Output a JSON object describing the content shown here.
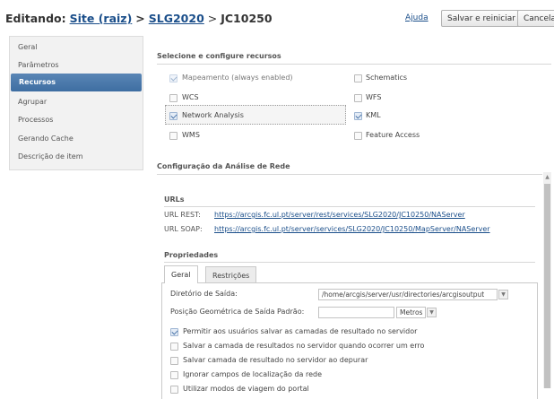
{
  "header": {
    "editing_label": "Editando:",
    "crumb_root": "Site (raiz)",
    "sep1": ">",
    "crumb_folder": "SLG2020",
    "sep2": ">",
    "service": "JC10250",
    "help_link": "Ajuda",
    "save_restart_button": "Salvar e reiniciar",
    "cancel_button": "Cancelar"
  },
  "sidebar": {
    "items": [
      {
        "label": "Geral",
        "active": false
      },
      {
        "label": "Parâmetros",
        "active": false
      },
      {
        "label": "Recursos",
        "active": true
      },
      {
        "label": "Agrupar",
        "active": false
      },
      {
        "label": "Processos",
        "active": false
      },
      {
        "label": "Gerando Cache",
        "active": false
      },
      {
        "label": "Descrição de item",
        "active": false
      }
    ]
  },
  "capabilities": {
    "title": "Selecione e configure recursos",
    "items": [
      {
        "label": "Mapeamento (always enabled)",
        "checked": true,
        "disabled": true
      },
      {
        "label": "Schematics",
        "checked": false
      },
      {
        "label": "WCS",
        "checked": false
      },
      {
        "label": "WFS",
        "checked": false
      },
      {
        "label": "Network Analysis",
        "checked": true,
        "selected": true
      },
      {
        "label": "KML",
        "checked": true
      },
      {
        "label": "WMS",
        "checked": false
      },
      {
        "label": "Feature Access",
        "checked": false
      }
    ]
  },
  "network_config": {
    "title": "Configuração da Análise de Rede",
    "urls_title": "URLs",
    "rest_label": "URL REST:",
    "rest_url": "https://arcgis.fc.ul.pt/server/rest/services/SLG2020/JC10250/NAServer",
    "soap_label": "URL SOAP:",
    "soap_url": "https://arcgis.fc.ul.pt/server/services/SLG2020/JC10250/MapServer/NAServer",
    "props_title": "Propriedades",
    "tabs": [
      {
        "label": "Geral",
        "active": true
      },
      {
        "label": "Restrições",
        "active": false
      }
    ],
    "output_dir_label": "Diretório de Saída:",
    "output_dir_value": "/home/arcgis/server/usr/directories/arcgisoutput",
    "default_geo_label": "Posição Geométrica de Saída Padrão:",
    "default_geo_value": "",
    "units_value": "Metros",
    "options": [
      {
        "label": "Permitir aos usuários salvar as camadas de resultado no servidor",
        "checked": true
      },
      {
        "label": "Salvar a camada de resultados no servidor quando ocorrer um erro",
        "checked": false
      },
      {
        "label": "Salvar camada de resultado no servidor ao depurar",
        "checked": false
      },
      {
        "label": "Ignorar campos de localização da rede",
        "checked": false
      },
      {
        "label": "Utilizar modos de viagem do portal",
        "checked": false
      }
    ]
  },
  "colors": {
    "accent": "#4a78ab",
    "link": "#1a4e8a"
  }
}
